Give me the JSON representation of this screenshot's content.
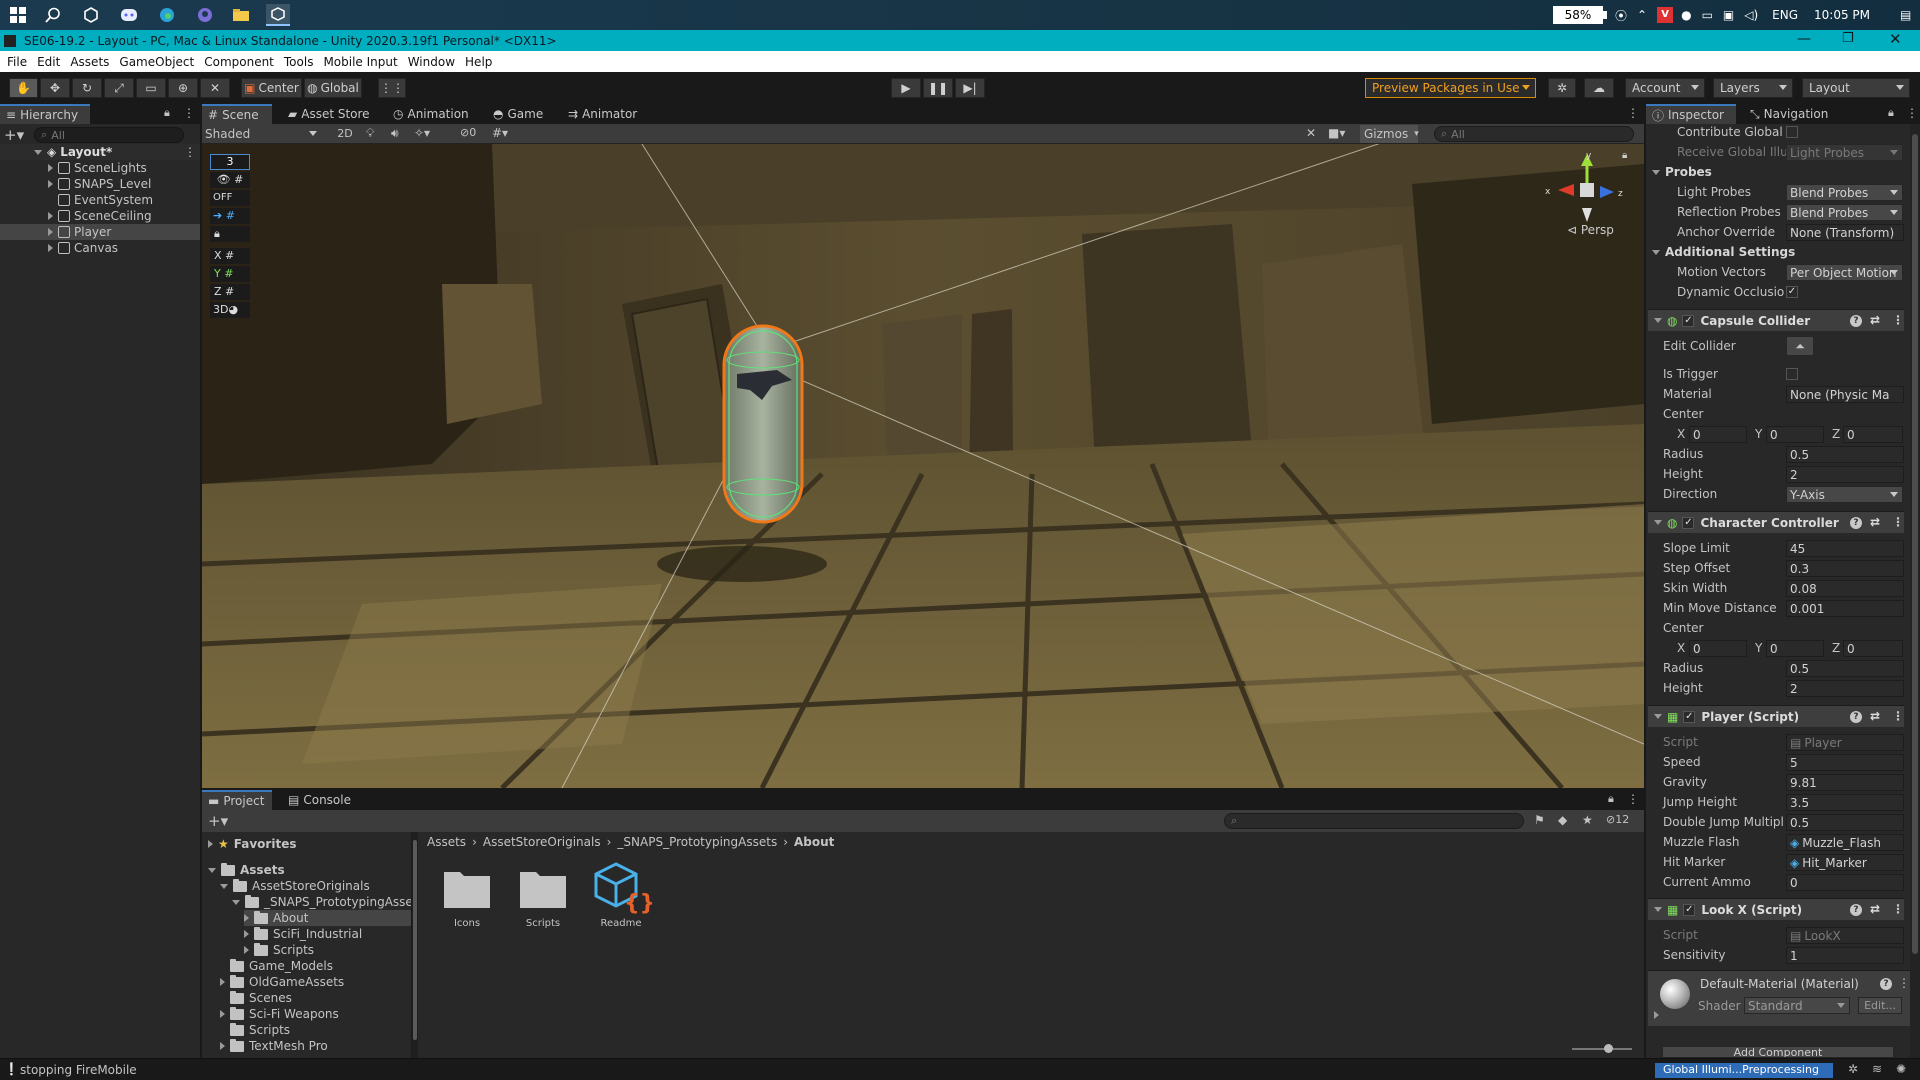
{
  "taskbar": {
    "battery": "58%",
    "language": "ENG",
    "time": "10:05 PM"
  },
  "window": {
    "title": "SE06-19.2 - Layout - PC, Mac & Linux Standalone - Unity 2020.3.19f1 Personal* <DX11>"
  },
  "menu": [
    "File",
    "Edit",
    "Assets",
    "GameObject",
    "Component",
    "Tools",
    "Mobile Input",
    "Window",
    "Help"
  ],
  "toolbar": {
    "pivot": "Center",
    "space": "Global",
    "preview_packages": "Preview Packages in Use",
    "account": "Account",
    "layers": "Layers",
    "layout": "Layout"
  },
  "hierarchy": {
    "tab": "Hierarchy",
    "search_placeholder": "All",
    "scene": "Layout*",
    "items": [
      "SceneLights",
      "SNAPS_Level",
      "EventSystem",
      "SceneCeiling",
      "Player",
      "Canvas"
    ]
  },
  "scene_view": {
    "tabs": [
      "Scene",
      "Asset Store",
      "Animation",
      "Game",
      "Animator"
    ],
    "shading": "Shaded",
    "mode_2d": "2D",
    "hidden_count": "0",
    "gizmos": "Gizmos",
    "search_placeholder": "All",
    "overlay_value": "3",
    "overlay_off": "OFF",
    "axis_labels": [
      "X",
      "Y",
      "Z",
      "3D"
    ],
    "gizmo_axes": [
      "x",
      "y",
      "z"
    ],
    "persp": "Persp"
  },
  "project": {
    "tabs": [
      "Project",
      "Console"
    ],
    "hidden_count": "12",
    "favorites": "Favorites",
    "assets": "Assets",
    "tree": [
      {
        "label": "AssetStoreOriginals",
        "depth": 1,
        "open": true
      },
      {
        "label": "_SNAPS_PrototypingAssets",
        "depth": 2,
        "open": true
      },
      {
        "label": "About",
        "depth": 3,
        "open": false
      },
      {
        "label": "SciFi_Industrial",
        "depth": 3,
        "open": false
      },
      {
        "label": "Scripts",
        "depth": 3,
        "open": false
      },
      {
        "label": "Game_Models",
        "depth": 1,
        "open": null
      },
      {
        "label": "OldGameAssets",
        "depth": 1,
        "open": false
      },
      {
        "label": "Scenes",
        "depth": 1,
        "open": null
      },
      {
        "label": "Sci-Fi Weapons",
        "depth": 1,
        "open": false
      },
      {
        "label": "Scripts",
        "depth": 1,
        "open": null
      },
      {
        "label": "TextMesh Pro",
        "depth": 1,
        "open": false
      }
    ],
    "breadcrumb": [
      "Assets",
      "AssetStoreOriginals",
      "_SNAPS_PrototypingAssets",
      "About"
    ],
    "files": [
      "Icons",
      "Scripts",
      "Readme"
    ]
  },
  "inspector": {
    "tabs": [
      "Inspector",
      "Navigation"
    ],
    "top": [
      {
        "label": "Contribute Global I",
        "type": "check",
        "value": ""
      },
      {
        "label": "Receive Global Illu",
        "type": "dd",
        "value": "Light Probes",
        "dim": true
      }
    ],
    "probes": {
      "title": "Probes",
      "rows": [
        {
          "label": "Light Probes",
          "value": "Blend Probes"
        },
        {
          "label": "Reflection Probes",
          "value": "Blend Probes"
        },
        {
          "label": "Anchor Override",
          "value": "None (Transform)"
        }
      ]
    },
    "additional": {
      "title": "Additional Settings",
      "motion_vectors_label": "Motion Vectors",
      "motion_vectors": "Per Object Motion",
      "dynamic_occlusion_label": "Dynamic Occlusio",
      "dynamic_occlusion": "✓"
    },
    "capsule": {
      "title": "Capsule Collider",
      "edit_collider": "Edit Collider",
      "is_trigger": "Is Trigger",
      "material_label": "Material",
      "material": "None (Physic Ma",
      "center_label": "Center",
      "center": {
        "x": "0",
        "y": "0",
        "z": "0"
      },
      "radius_label": "Radius",
      "radius": "0.5",
      "height_label": "Height",
      "height": "2",
      "direction_label": "Direction",
      "direction": "Y-Axis"
    },
    "character": {
      "title": "Character Controller",
      "slope_label": "Slope Limit",
      "slope": "45",
      "step_label": "Step Offset",
      "step": "0.3",
      "skin_label": "Skin Width",
      "skin": "0.08",
      "min_move_label": "Min Move Distance",
      "min_move": "0.001",
      "center_label": "Center",
      "center": {
        "x": "0",
        "y": "0",
        "z": "0"
      },
      "radius_label": "Radius",
      "radius": "0.5",
      "height_label": "Height",
      "height": "2"
    },
    "player": {
      "title": "Player (Script)",
      "script_label": "Script",
      "script": "Player",
      "speed_label": "Speed",
      "speed": "5",
      "gravity_label": "Gravity",
      "gravity": "9.81",
      "jump_label": "Jump Height",
      "jump": "3.5",
      "double_jump_label": "Double Jump Multipli",
      "double_jump": "0.5",
      "muzzle_label": "Muzzle Flash",
      "muzzle": "Muzzle_Flash",
      "hit_label": "Hit Marker",
      "hit": "Hit_Marker",
      "ammo_label": "Current Ammo",
      "ammo": "0"
    },
    "lookx": {
      "title": "Look X (Script)",
      "script_label": "Script",
      "script": "LookX",
      "sensitivity_label": "Sensitivity",
      "sensitivity": "1"
    },
    "material": {
      "title": "Default-Material (Material)",
      "shader_label": "Shader",
      "shader": "Standard",
      "edit": "Edit..."
    },
    "add_component": "Add Component"
  },
  "status": {
    "message": "stopping FireMobile",
    "progress": "Global Illumi...Preprocessing"
  }
}
